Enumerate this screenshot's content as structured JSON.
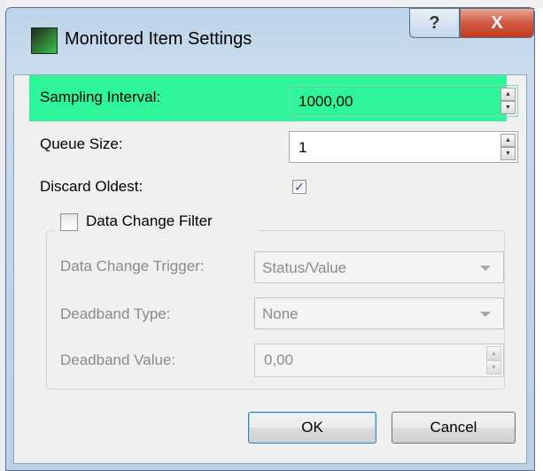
{
  "window": {
    "title": "Monitored Item Settings",
    "help_glyph": "?",
    "close_glyph": "X"
  },
  "fields": {
    "sampling_interval": {
      "label": "Sampling Interval:",
      "value": "1000,00"
    },
    "queue_size": {
      "label": "Queue Size:",
      "value": "1"
    },
    "discard_oldest": {
      "label": "Discard Oldest:",
      "checked": true,
      "check_glyph": "✓"
    }
  },
  "filter_group": {
    "title": "Data Change Filter",
    "enabled": false,
    "trigger": {
      "label": "Data Change Trigger:",
      "value": "Status/Value"
    },
    "deadband_type": {
      "label": "Deadband Type:",
      "value": "None"
    },
    "deadband_value": {
      "label": "Deadband Value:",
      "value": "0,00"
    }
  },
  "buttons": {
    "ok": "OK",
    "cancel": "Cancel"
  },
  "icons": {
    "app": "monitored-item-app-icon",
    "spin_up": "▲",
    "spin_down": "▼"
  },
  "colors": {
    "highlight": "#2ef59a",
    "close_button": "#c0391f",
    "titlebar": "#c9daec"
  }
}
